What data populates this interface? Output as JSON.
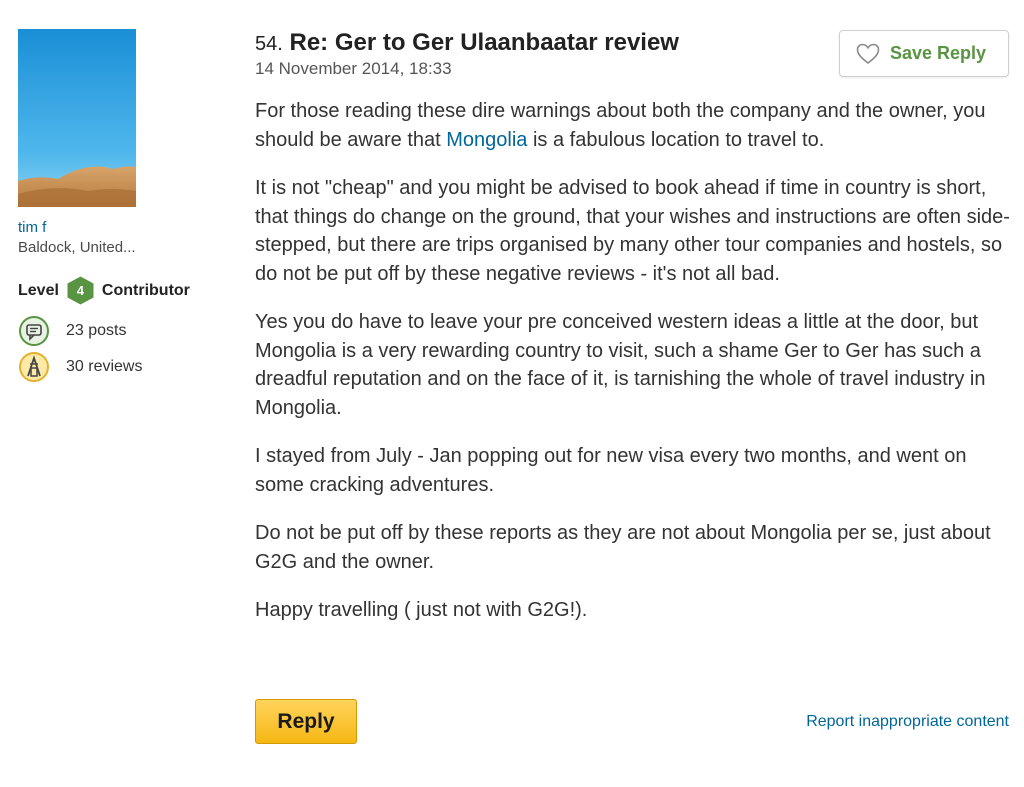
{
  "author": {
    "name": "tim f",
    "location": "Baldock, United...",
    "level_prefix": "Level",
    "level": "4",
    "level_suffix": "Contributor",
    "posts": "23 posts",
    "reviews": "30 reviews",
    "avatar_icon": "desert-dunes-photo"
  },
  "post": {
    "number": "54.",
    "title": "Re: Ger to Ger Ulaanbaatar review",
    "date": "14 November 2014, 18:33",
    "save_label": "Save Reply",
    "p1_before": "For those reading these dire warnings about both the company and the owner, you should be aware that ",
    "p1_link": "Mongolia",
    "p1_after": " is a fabulous location to travel to.",
    "p2": "It is not \"cheap\" and you might be advised to book ahead if time in country is short, that things do change on the ground, that your wishes and instructions are often side-stepped, but there are trips organised by many other tour companies and hostels, so do not be put off by these negative reviews - it's not all bad.",
    "p3": "Yes you do have to leave your pre conceived western ideas a little at the door, but Mongolia is a very rewarding country to visit, such a shame Ger to Ger has such a dreadful reputation and on the face of it, is tarnishing the whole of travel industry in Mongolia.",
    "p4": "I stayed from July - Jan popping out for new visa every two months, and went on some cracking adventures.",
    "p5": "Do not be put off by these reports as they are not about Mongolia per se, just about G2G and the owner.",
    "p6": "Happy travelling ( just not with G2G!)."
  },
  "footer": {
    "reply_label": "Reply",
    "report_label": "Report inappropriate content"
  },
  "colors": {
    "link": "#006699",
    "level_badge": "#589442",
    "save_text": "#589442",
    "reply_button": "#f5b713"
  }
}
